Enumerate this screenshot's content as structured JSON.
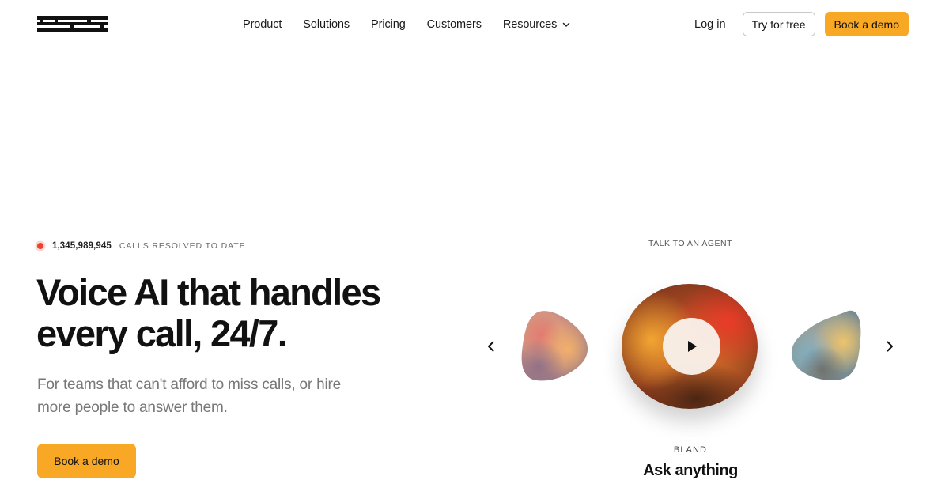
{
  "header": {
    "logo": {
      "text": "bland",
      "icon": "bland-wordmark-logo"
    },
    "nav": [
      {
        "label": "Product"
      },
      {
        "label": "Solutions"
      },
      {
        "label": "Pricing"
      },
      {
        "label": "Customers"
      },
      {
        "label": "Resources",
        "icon": "chevron-down-icon"
      }
    ],
    "login_label": "Log in",
    "try_label": "Try for free",
    "demo_label": "Book a demo"
  },
  "hero": {
    "stat_number": "1,345,989,945",
    "stat_label": "CALLS RESOLVED TO DATE",
    "title": "Voice AI that handles every call, 24/7.",
    "subtitle": "For teams that can't afford to miss calls, or hire more people to answer them.",
    "cta_label": "Book a demo"
  },
  "agent": {
    "section_label": "TALK TO AN AGENT",
    "name": "BLAND",
    "tagline": "Ask anything",
    "prev_icon": "chevron-left-icon",
    "next_icon": "chevron-right-icon",
    "play_icon": "play-icon"
  },
  "colors": {
    "accent": "#f9a825",
    "live_dot": "#e8452c",
    "text": "#111111",
    "muted": "#777777",
    "border": "#d9d9d9"
  }
}
